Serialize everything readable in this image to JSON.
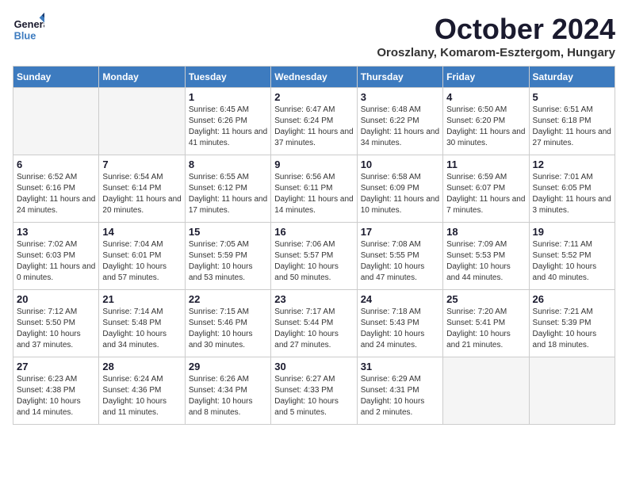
{
  "header": {
    "logo_general": "General",
    "logo_blue": "Blue",
    "month_title": "October 2024",
    "subtitle": "Oroszlany, Komarom-Esztergom, Hungary"
  },
  "columns": [
    "Sunday",
    "Monday",
    "Tuesday",
    "Wednesday",
    "Thursday",
    "Friday",
    "Saturday"
  ],
  "weeks": [
    {
      "days": [
        {
          "num": "",
          "info": "",
          "empty": true
        },
        {
          "num": "",
          "info": "",
          "empty": true
        },
        {
          "num": "1",
          "info": "Sunrise: 6:45 AM\nSunset: 6:26 PM\nDaylight: 11 hours and 41 minutes.",
          "empty": false
        },
        {
          "num": "2",
          "info": "Sunrise: 6:47 AM\nSunset: 6:24 PM\nDaylight: 11 hours and 37 minutes.",
          "empty": false
        },
        {
          "num": "3",
          "info": "Sunrise: 6:48 AM\nSunset: 6:22 PM\nDaylight: 11 hours and 34 minutes.",
          "empty": false
        },
        {
          "num": "4",
          "info": "Sunrise: 6:50 AM\nSunset: 6:20 PM\nDaylight: 11 hours and 30 minutes.",
          "empty": false
        },
        {
          "num": "5",
          "info": "Sunrise: 6:51 AM\nSunset: 6:18 PM\nDaylight: 11 hours and 27 minutes.",
          "empty": false
        }
      ]
    },
    {
      "days": [
        {
          "num": "6",
          "info": "Sunrise: 6:52 AM\nSunset: 6:16 PM\nDaylight: 11 hours and 24 minutes.",
          "empty": false
        },
        {
          "num": "7",
          "info": "Sunrise: 6:54 AM\nSunset: 6:14 PM\nDaylight: 11 hours and 20 minutes.",
          "empty": false
        },
        {
          "num": "8",
          "info": "Sunrise: 6:55 AM\nSunset: 6:12 PM\nDaylight: 11 hours and 17 minutes.",
          "empty": false
        },
        {
          "num": "9",
          "info": "Sunrise: 6:56 AM\nSunset: 6:11 PM\nDaylight: 11 hours and 14 minutes.",
          "empty": false
        },
        {
          "num": "10",
          "info": "Sunrise: 6:58 AM\nSunset: 6:09 PM\nDaylight: 11 hours and 10 minutes.",
          "empty": false
        },
        {
          "num": "11",
          "info": "Sunrise: 6:59 AM\nSunset: 6:07 PM\nDaylight: 11 hours and 7 minutes.",
          "empty": false
        },
        {
          "num": "12",
          "info": "Sunrise: 7:01 AM\nSunset: 6:05 PM\nDaylight: 11 hours and 3 minutes.",
          "empty": false
        }
      ]
    },
    {
      "days": [
        {
          "num": "13",
          "info": "Sunrise: 7:02 AM\nSunset: 6:03 PM\nDaylight: 11 hours and 0 minutes.",
          "empty": false
        },
        {
          "num": "14",
          "info": "Sunrise: 7:04 AM\nSunset: 6:01 PM\nDaylight: 10 hours and 57 minutes.",
          "empty": false
        },
        {
          "num": "15",
          "info": "Sunrise: 7:05 AM\nSunset: 5:59 PM\nDaylight: 10 hours and 53 minutes.",
          "empty": false
        },
        {
          "num": "16",
          "info": "Sunrise: 7:06 AM\nSunset: 5:57 PM\nDaylight: 10 hours and 50 minutes.",
          "empty": false
        },
        {
          "num": "17",
          "info": "Sunrise: 7:08 AM\nSunset: 5:55 PM\nDaylight: 10 hours and 47 minutes.",
          "empty": false
        },
        {
          "num": "18",
          "info": "Sunrise: 7:09 AM\nSunset: 5:53 PM\nDaylight: 10 hours and 44 minutes.",
          "empty": false
        },
        {
          "num": "19",
          "info": "Sunrise: 7:11 AM\nSunset: 5:52 PM\nDaylight: 10 hours and 40 minutes.",
          "empty": false
        }
      ]
    },
    {
      "days": [
        {
          "num": "20",
          "info": "Sunrise: 7:12 AM\nSunset: 5:50 PM\nDaylight: 10 hours and 37 minutes.",
          "empty": false
        },
        {
          "num": "21",
          "info": "Sunrise: 7:14 AM\nSunset: 5:48 PM\nDaylight: 10 hours and 34 minutes.",
          "empty": false
        },
        {
          "num": "22",
          "info": "Sunrise: 7:15 AM\nSunset: 5:46 PM\nDaylight: 10 hours and 30 minutes.",
          "empty": false
        },
        {
          "num": "23",
          "info": "Sunrise: 7:17 AM\nSunset: 5:44 PM\nDaylight: 10 hours and 27 minutes.",
          "empty": false
        },
        {
          "num": "24",
          "info": "Sunrise: 7:18 AM\nSunset: 5:43 PM\nDaylight: 10 hours and 24 minutes.",
          "empty": false
        },
        {
          "num": "25",
          "info": "Sunrise: 7:20 AM\nSunset: 5:41 PM\nDaylight: 10 hours and 21 minutes.",
          "empty": false
        },
        {
          "num": "26",
          "info": "Sunrise: 7:21 AM\nSunset: 5:39 PM\nDaylight: 10 hours and 18 minutes.",
          "empty": false
        }
      ]
    },
    {
      "days": [
        {
          "num": "27",
          "info": "Sunrise: 6:23 AM\nSunset: 4:38 PM\nDaylight: 10 hours and 14 minutes.",
          "empty": false
        },
        {
          "num": "28",
          "info": "Sunrise: 6:24 AM\nSunset: 4:36 PM\nDaylight: 10 hours and 11 minutes.",
          "empty": false
        },
        {
          "num": "29",
          "info": "Sunrise: 6:26 AM\nSunset: 4:34 PM\nDaylight: 10 hours and 8 minutes.",
          "empty": false
        },
        {
          "num": "30",
          "info": "Sunrise: 6:27 AM\nSunset: 4:33 PM\nDaylight: 10 hours and 5 minutes.",
          "empty": false
        },
        {
          "num": "31",
          "info": "Sunrise: 6:29 AM\nSunset: 4:31 PM\nDaylight: 10 hours and 2 minutes.",
          "empty": false
        },
        {
          "num": "",
          "info": "",
          "empty": true
        },
        {
          "num": "",
          "info": "",
          "empty": true
        }
      ]
    }
  ]
}
